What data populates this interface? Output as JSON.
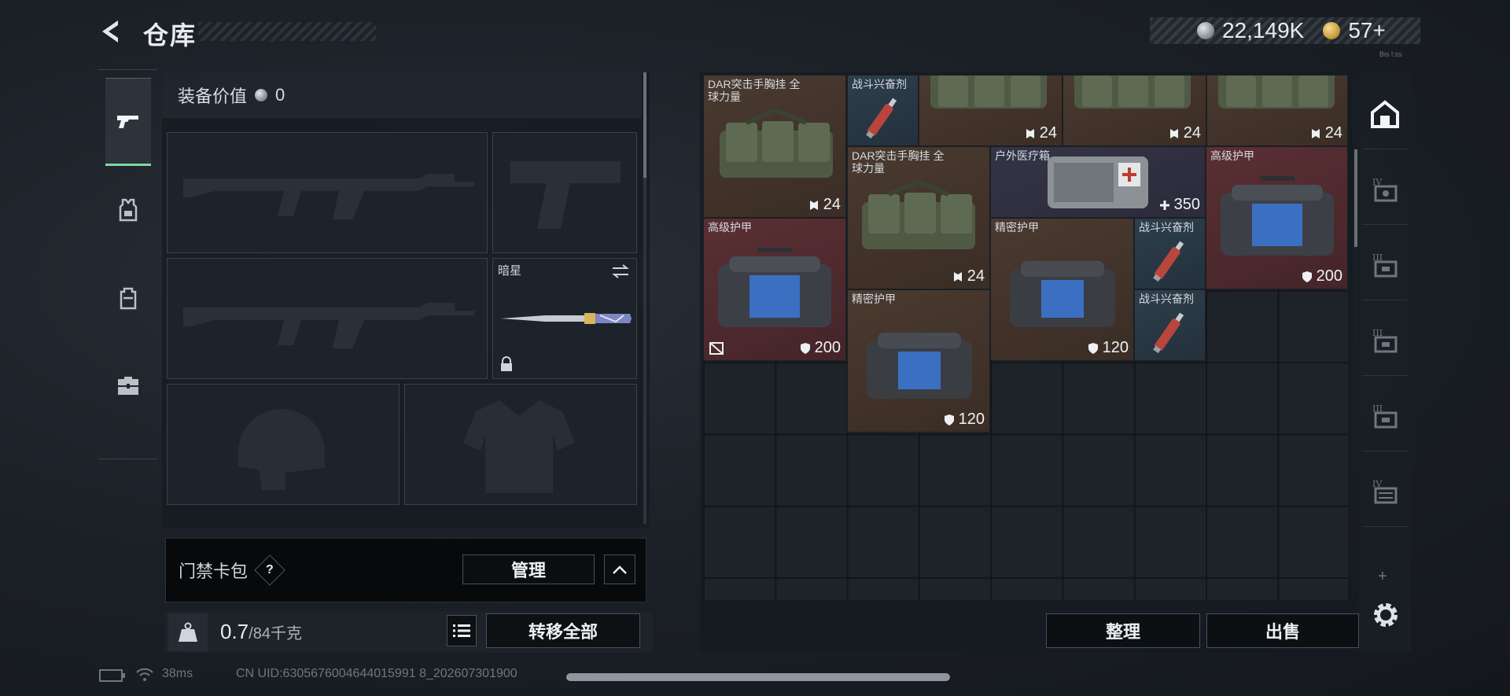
{
  "header": {
    "title": "仓库",
    "currency_silver": "22,149K",
    "currency_gold": "57+",
    "tiny_code": "Bis l:ss"
  },
  "left_nav": {
    "items": [
      {
        "icon": "pistol-icon",
        "active": true
      },
      {
        "icon": "armor-vest-icon",
        "active": false
      },
      {
        "icon": "backpack-icon",
        "active": false
      },
      {
        "icon": "toolbox-icon",
        "active": false
      }
    ]
  },
  "equipment": {
    "value_label": "装备价值",
    "value": "0",
    "melee_slot_name": "暗星"
  },
  "access_card": {
    "label": "门禁卡包",
    "help": "?",
    "manage_label": "管理"
  },
  "weight": {
    "current": "0.7",
    "max": "/84千克",
    "transfer_all_label": "转移全部"
  },
  "storage": {
    "items": [
      {
        "name": "DAR突击手胸挂 全球力量",
        "value": "24"
      },
      {
        "name": "战斗兴奋剂",
        "value": ""
      },
      {
        "name": "",
        "value": "24"
      },
      {
        "name": "",
        "value": "24"
      },
      {
        "name": "",
        "value": "24"
      },
      {
        "name": "DAR突击手胸挂 全球力量",
        "value": "24"
      },
      {
        "name": "户外医疗箱",
        "value": "350"
      },
      {
        "name": "高级护甲",
        "value": "200"
      },
      {
        "name": "高级护甲",
        "value": "200"
      },
      {
        "name": "精密护甲",
        "value": "120"
      },
      {
        "name": "战斗兴奋剂",
        "value": ""
      },
      {
        "name": "精密护甲",
        "value": "120"
      },
      {
        "name": "战斗兴奋剂",
        "value": ""
      }
    ],
    "sort_label": "整理",
    "sell_label": "出售"
  },
  "filters": {
    "tiers": [
      "IV",
      "III",
      "III",
      "III",
      "IV"
    ],
    "add": "+"
  },
  "status_bar": {
    "ping": "38ms",
    "uid": "CN UID:6305676004644015991 8_202607301900"
  }
}
